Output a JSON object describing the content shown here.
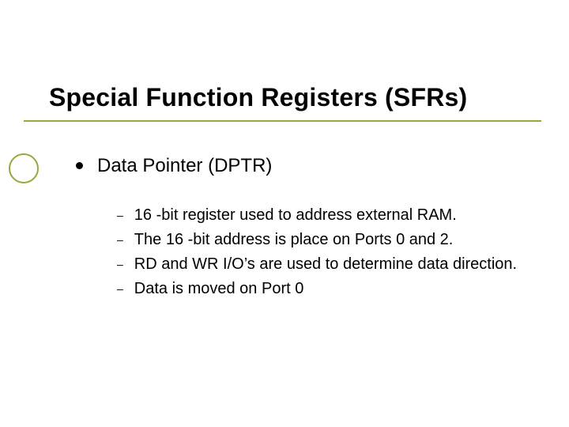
{
  "slide": {
    "title": "Special Function Registers (SFRs)",
    "topic": {
      "label": "Data Pointer (DPTR)",
      "points": [
        "16 -bit register used to address external RAM.",
        "The 16 -bit address is place on Ports 0 and 2.",
        "RD and WR I/O’s are used to determine data direction.",
        "Data is moved on Port 0"
      ]
    }
  },
  "accent_color": "#97a83d"
}
